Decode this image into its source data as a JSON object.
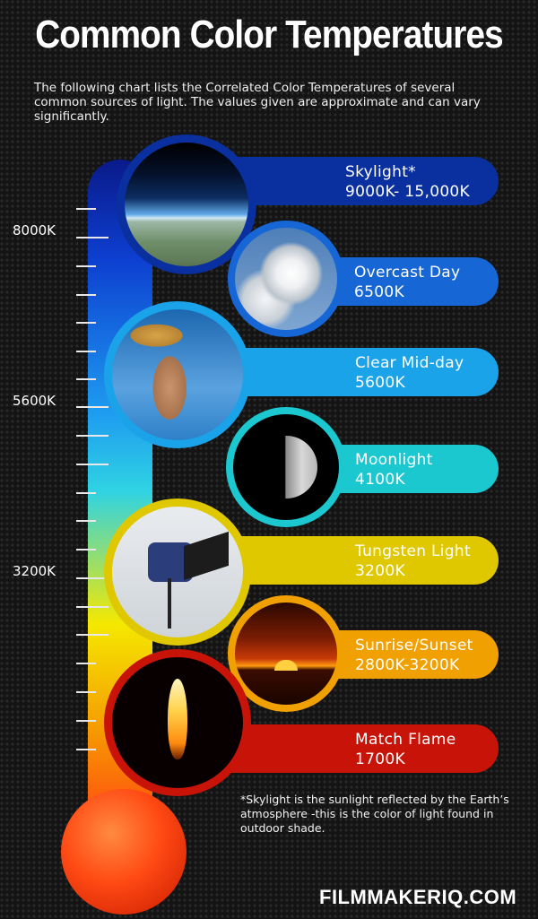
{
  "title": "Common Color Temperatures",
  "intro": "The following chart lists the Correlated Color Temperatures of several common sources of light. The values given are approximate and can vary significantly.",
  "scale_labels": [
    "8000K",
    "5600K",
    "3200K"
  ],
  "items": [
    {
      "name": "Skylight*",
      "value": "9000K- 15,000K",
      "color": "#0a2f9e"
    },
    {
      "name": "Overcast Day",
      "value": "6500K",
      "color": "#1766d6"
    },
    {
      "name": "Clear Mid-day",
      "value": "5600K",
      "color": "#1aa3e8"
    },
    {
      "name": "Moonlight",
      "value": "4100K",
      "color": "#1bc8cf"
    },
    {
      "name": "Tungsten Light",
      "value": "3200K",
      "color": "#e0c800"
    },
    {
      "name": "Sunrise/Sunset",
      "value": "2800K-3200K",
      "color": "#f0a000"
    },
    {
      "name": "Match Flame",
      "value": "1700K",
      "color": "#c81408"
    }
  ],
  "footnote": "*Skylight is the sunlight reflected by the Earth’s atmosphere -this is the color of light found in outdoor shade.",
  "brand": "FILMMAKERIQ.COM",
  "icons": [
    "sky-earth-photo",
    "clouds-photo",
    "sunhat-woman-photo",
    "half-moon-photo",
    "studio-light-photo",
    "sunset-photo",
    "candle-flame-photo"
  ]
}
